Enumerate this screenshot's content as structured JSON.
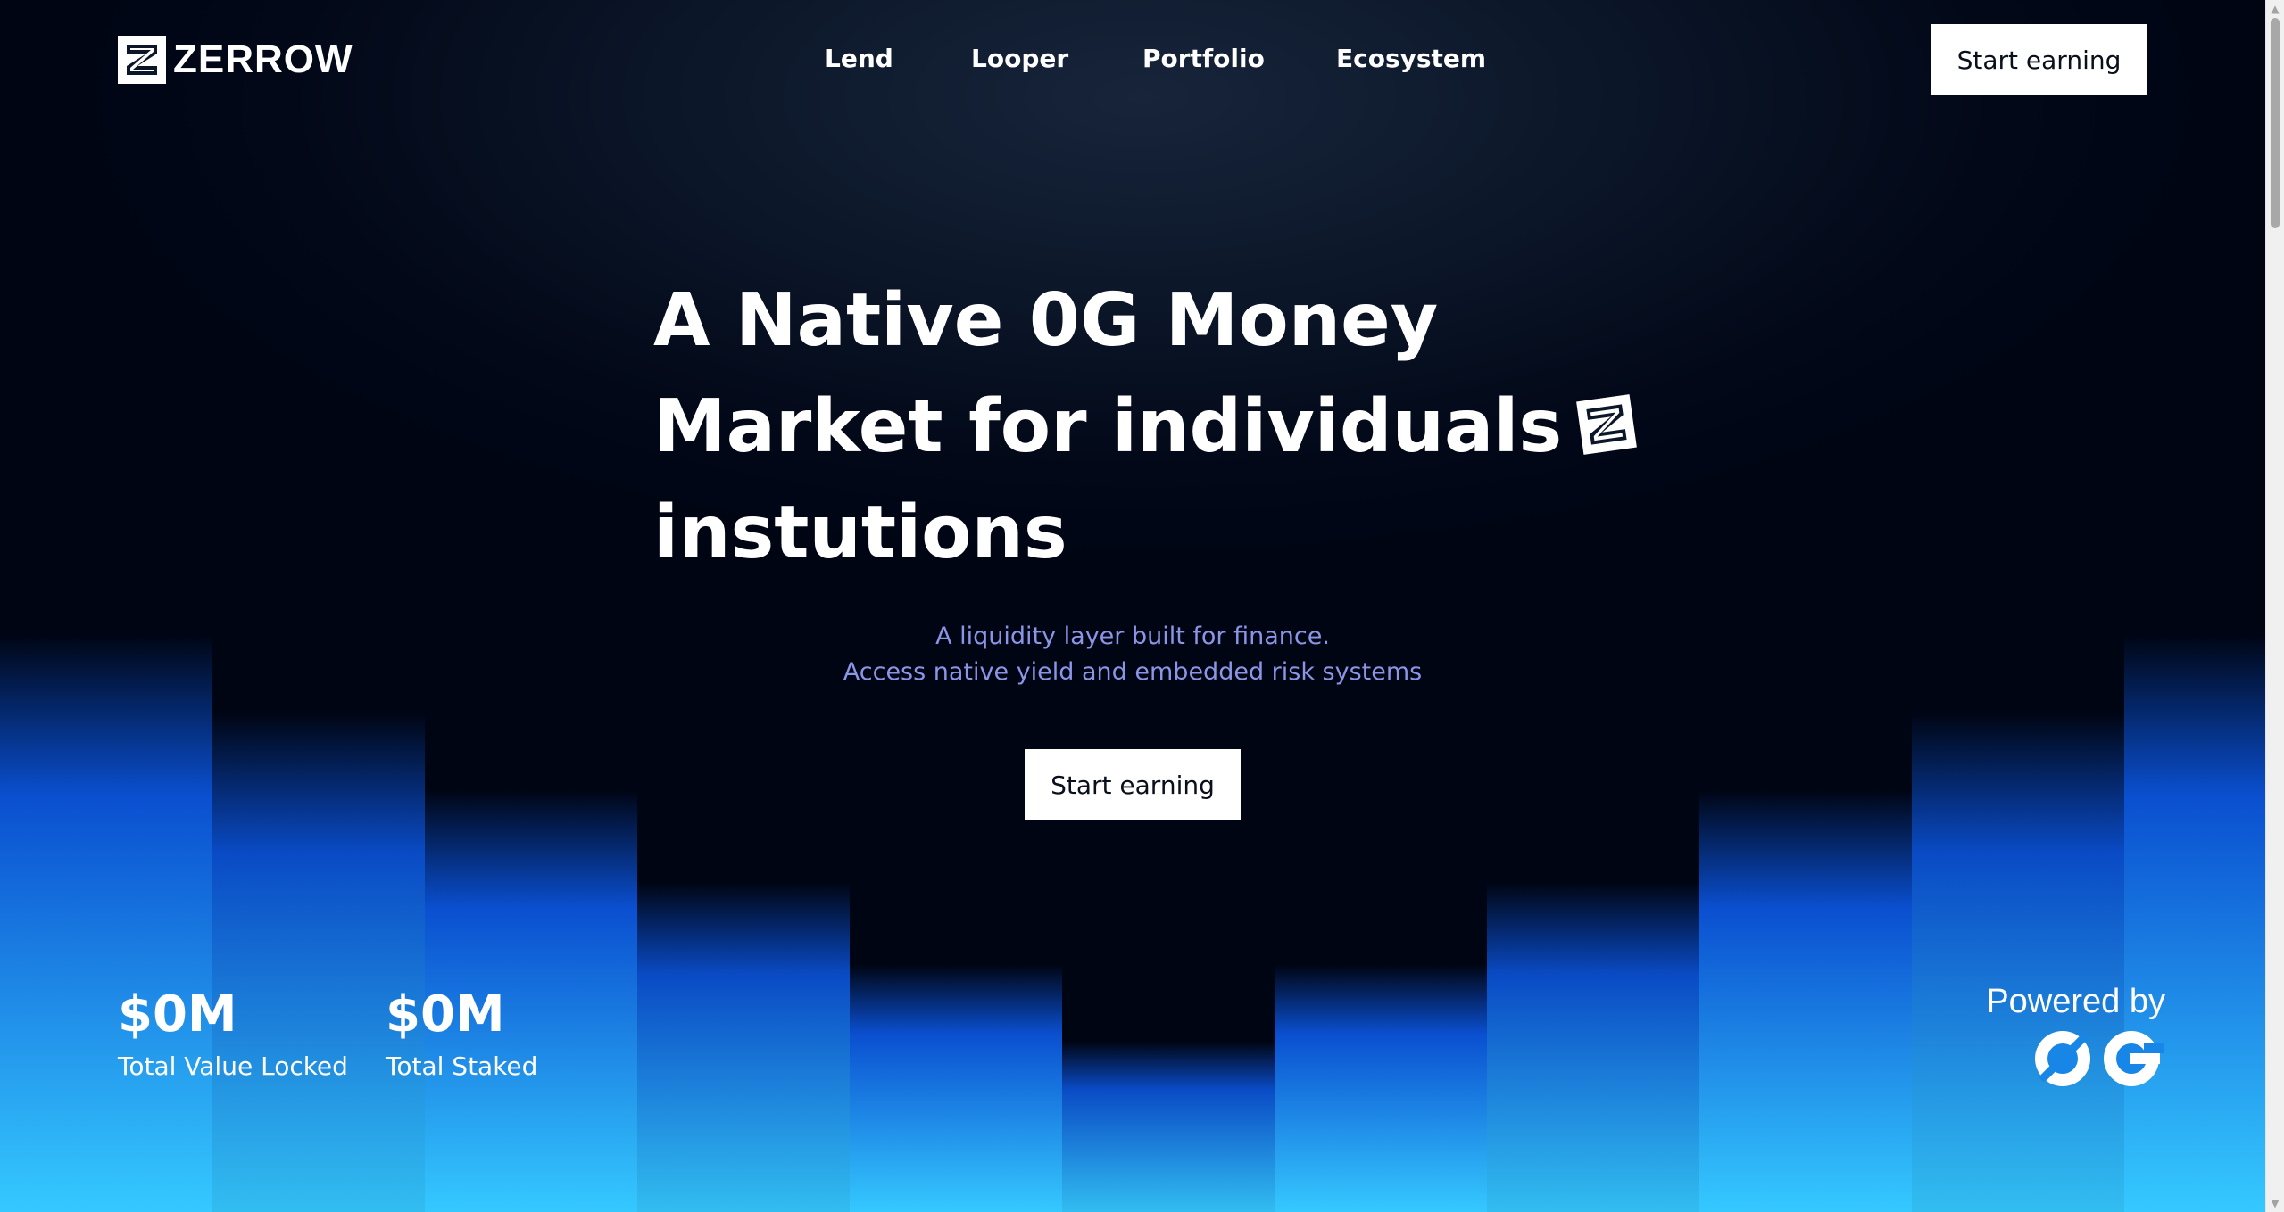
{
  "brand": {
    "name": "ZERROW",
    "logo_icon": "zerrow-bolt-icon"
  },
  "nav": {
    "links": [
      "Lend",
      "Looper",
      "Portfolio",
      "Ecosystem"
    ],
    "cta_label": "Start earning"
  },
  "hero": {
    "title_lines": [
      "A Native 0G Money",
      "Market for individuals",
      "instutions"
    ],
    "inline_icon": "zerrow-bolt-icon",
    "subtitle_lines": [
      "A liquidity layer built for finance.",
      "Access native yield and embedded risk systems"
    ],
    "cta_label": "Start earning"
  },
  "stats": [
    {
      "value": "$0M",
      "label": "Total Value Locked"
    },
    {
      "value": "$0M",
      "label": "Total Staked"
    }
  ],
  "powered_by": {
    "label": "Powered by",
    "logo_icon": "0g-logo"
  },
  "colors": {
    "background_top": "#17243a",
    "background_dark": "#000514",
    "column_bright": "#35c9ff",
    "column_mid": "#0a4fd0",
    "subtitle": "#8b95e6",
    "button_bg": "#ffffff",
    "button_text": "#0a0f1c"
  }
}
